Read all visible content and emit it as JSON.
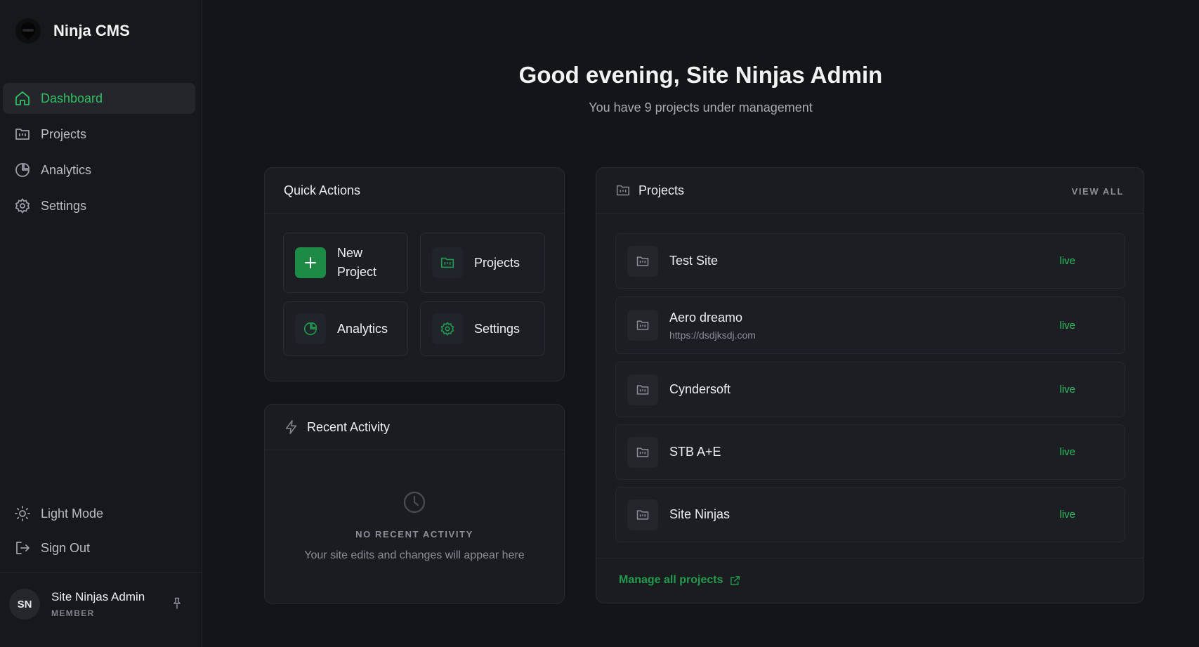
{
  "brand": {
    "name": "Ninja CMS",
    "logo_icon": "ninja-logo-icon"
  },
  "sidebar": {
    "items": [
      {
        "label": "Dashboard",
        "icon": "home-icon",
        "active": true
      },
      {
        "label": "Projects",
        "icon": "folder-icon",
        "active": false
      },
      {
        "label": "Analytics",
        "icon": "pie-chart-icon",
        "active": false
      },
      {
        "label": "Settings",
        "icon": "gear-icon",
        "active": false
      }
    ],
    "bottom_items": [
      {
        "label": "Light Mode",
        "icon": "sun-icon"
      },
      {
        "label": "Sign Out",
        "icon": "sign-out-icon"
      }
    ],
    "user": {
      "initials": "SN",
      "name": "Site Ninjas Admin",
      "role": "MEMBER",
      "pin_icon": "pin-icon"
    }
  },
  "header": {
    "greeting": "Good evening, Site Ninjas Admin",
    "subtitle": "You have 9 projects under management"
  },
  "quick_actions": {
    "title": "Quick Actions",
    "tiles": [
      {
        "label": "New Project",
        "icon": "plus-icon"
      },
      {
        "label": "Projects",
        "icon": "folder-icon"
      },
      {
        "label": "Analytics",
        "icon": "pie-chart-icon"
      },
      {
        "label": "Settings",
        "icon": "gear-icon"
      }
    ]
  },
  "recent_activity": {
    "title": "Recent Activity",
    "icon": "lightning-icon",
    "empty_title": "NO RECENT ACTIVITY",
    "empty_desc": "Your site edits and changes will appear here",
    "empty_icon": "clock-icon"
  },
  "projects": {
    "title": "Projects",
    "view_all": "VIEW ALL",
    "items": [
      {
        "name": "Test Site",
        "url": "",
        "status": "live"
      },
      {
        "name": "Aero dreamo",
        "url": "https://dsdjksdj.com",
        "status": "live"
      },
      {
        "name": "Cyndersoft",
        "url": "",
        "status": "live"
      },
      {
        "name": "STB A+E",
        "url": "",
        "status": "live"
      },
      {
        "name": "Site Ninjas",
        "url": "",
        "status": "live"
      }
    ],
    "manage_label": "Manage all projects",
    "manage_icon": "external-link-icon"
  },
  "colors": {
    "accent": "#2fbf62",
    "background": "#141518",
    "sidebar": "#17181c",
    "card": "#1b1c20"
  }
}
